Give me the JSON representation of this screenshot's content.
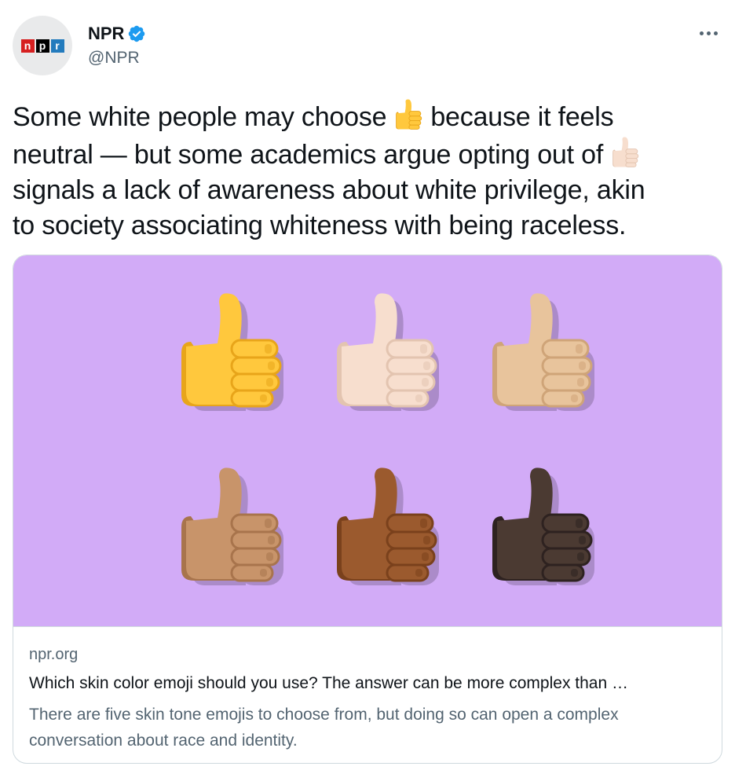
{
  "author": {
    "name": "NPR",
    "handle": "@NPR",
    "logo_letters": [
      "n",
      "p",
      "r"
    ],
    "verified_icon": "verified-badge-icon"
  },
  "tweet": {
    "text_lines": [
      "Some white people may choose",
      "because it feels",
      "neutral — but some academics argue opting out of",
      "signals a lack of awareness about white privilege, akin",
      "to society associating whiteness with being raceless."
    ]
  },
  "card": {
    "domain": "npr.org",
    "title": "Which skin color emoji should you use? The answer can be more complex than …",
    "description_lines": [
      "There are five skin tone emojis to choose from, but doing so can open a complex",
      "conversation about race and identity."
    ],
    "image_background": "#d2abf7",
    "thumbs_colors": [
      {
        "skin": "#ffc83d",
        "shade": "#e8a51a"
      },
      {
        "skin": "#f7dece",
        "shade": "#e3c4b0"
      },
      {
        "skin": "#e8c49c",
        "shade": "#cfa478"
      },
      {
        "skin": "#c8946a",
        "shade": "#a8744c"
      },
      {
        "skin": "#9b5a2e",
        "shade": "#7a411c"
      },
      {
        "skin": "#4b3a32",
        "shade": "#2e2220"
      }
    ]
  },
  "colors": {
    "brand_blue": "#1d9bf0",
    "secondary_text": "#536471",
    "border": "#cfd9de"
  }
}
